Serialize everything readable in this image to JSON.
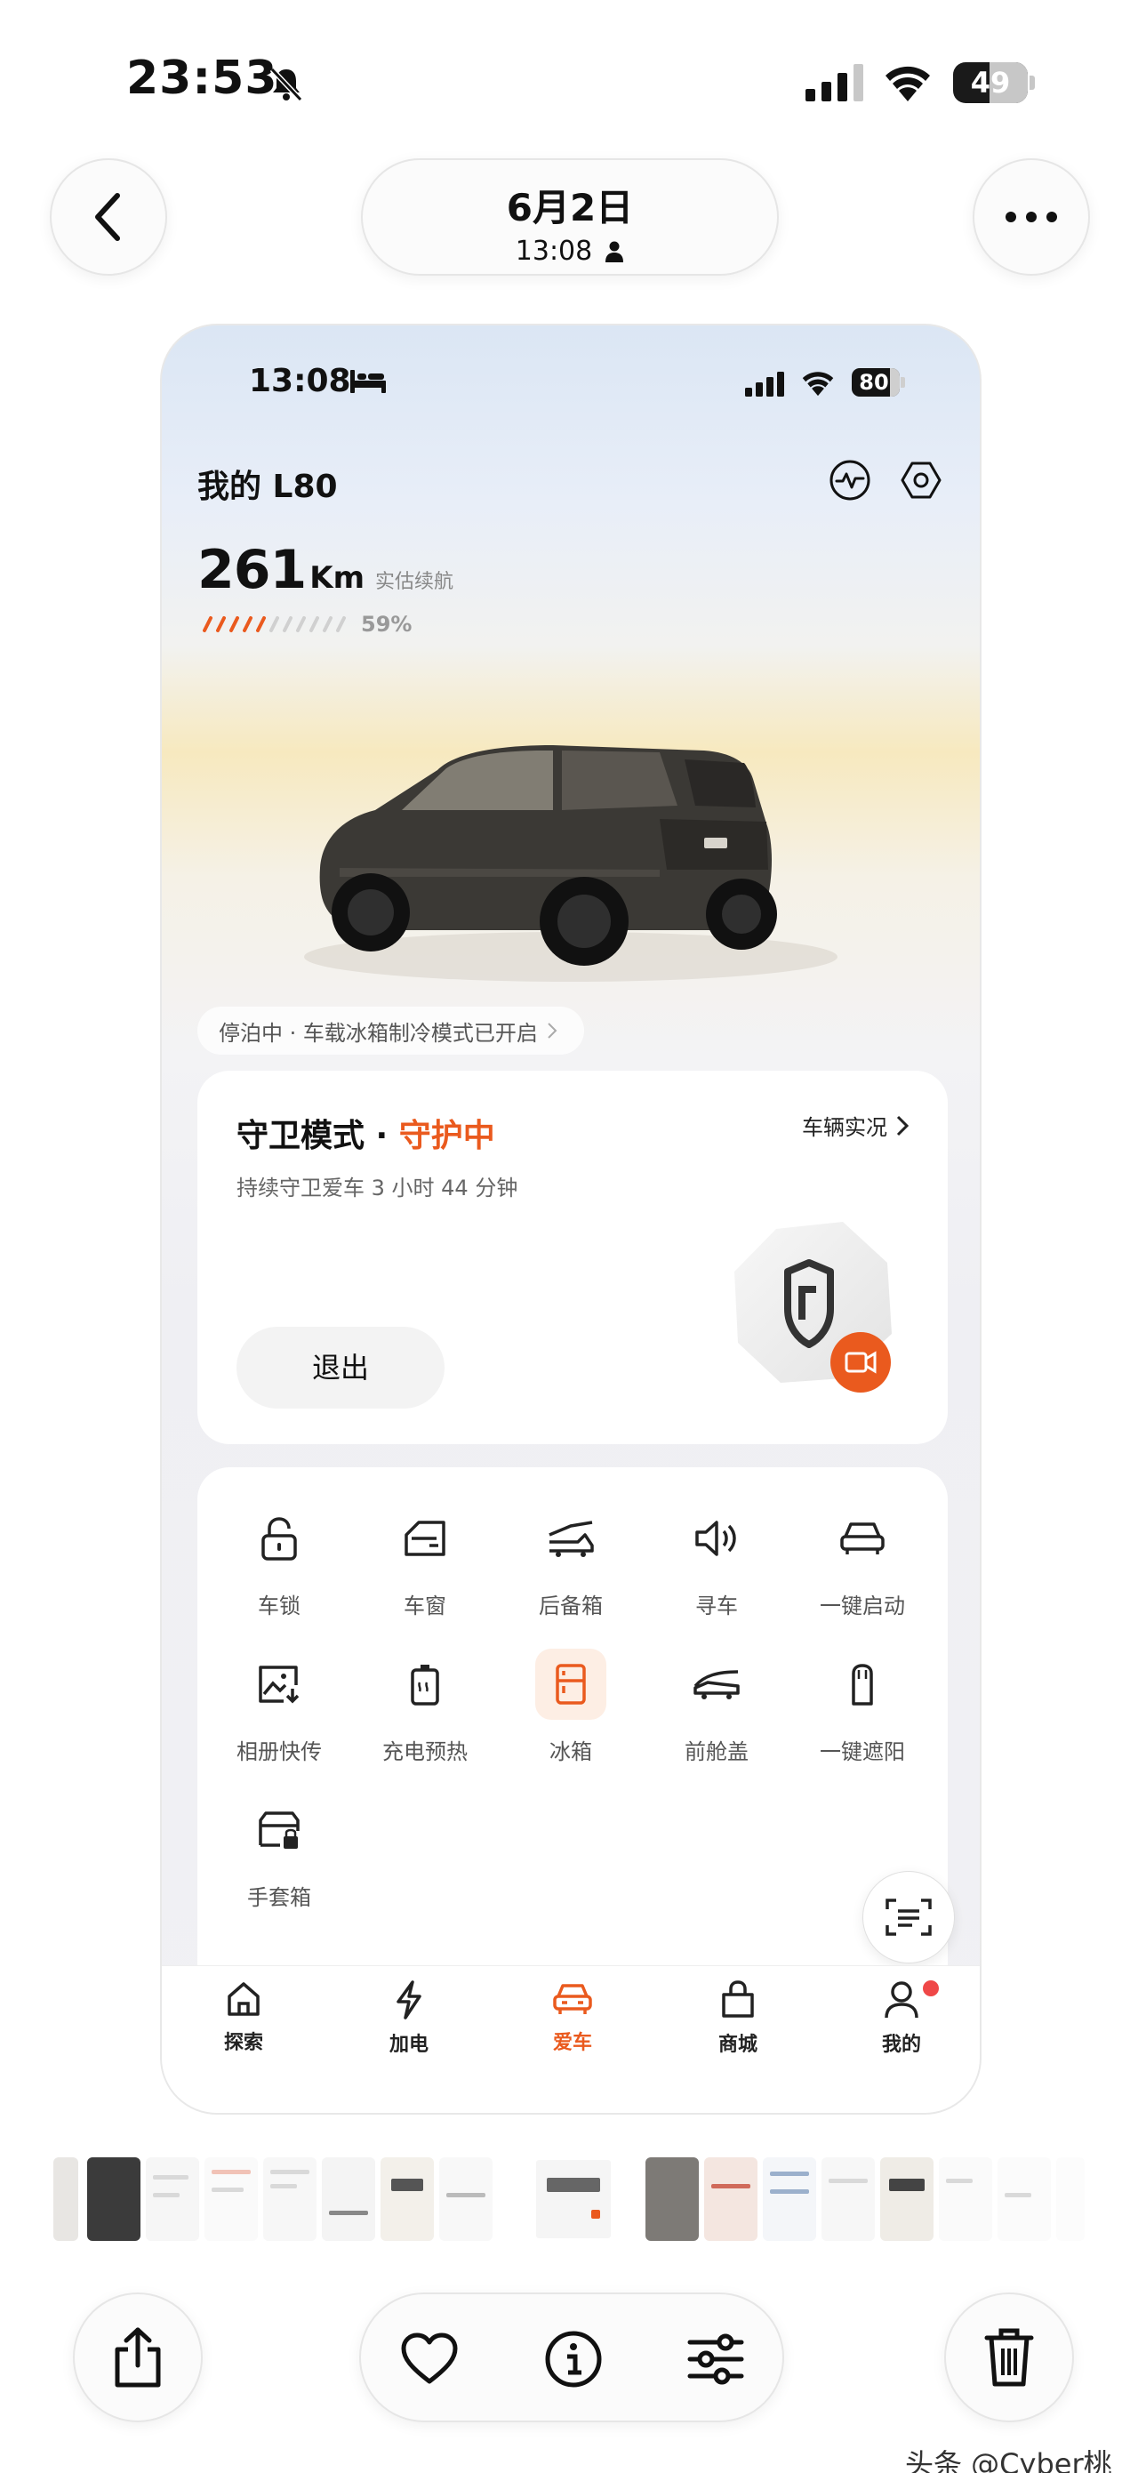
{
  "os_status": {
    "time": "23:53",
    "battery": "49",
    "battery_level": 0.49
  },
  "photo_header": {
    "date": "6月2日",
    "time": "13:08"
  },
  "app": {
    "status": {
      "time": "13:08",
      "battery": "80",
      "battery_level": 0.8
    },
    "car_name": "我的 L80",
    "range": {
      "value": "261",
      "unit": "Km",
      "label": "实估续航",
      "percent_text": "59%",
      "percent": 59
    },
    "park_notice": "停泊中 · 车载冰箱制冷模式已开启",
    "guard": {
      "title": "守卫模式 · ",
      "status": "守护中",
      "subtitle": "持续守卫爱车 3 小时 44 分钟",
      "link": "车辆实况",
      "exit": "退出"
    },
    "controls": [
      {
        "label": "车锁",
        "icon": "lock-icon"
      },
      {
        "label": "车窗",
        "icon": "car-window-icon"
      },
      {
        "label": "后备箱",
        "icon": "trunk-icon"
      },
      {
        "label": "寻车",
        "icon": "speaker-icon"
      },
      {
        "label": "一键启动",
        "icon": "car-start-icon"
      },
      {
        "label": "相册快传",
        "icon": "photo-transfer-icon"
      },
      {
        "label": "充电预热",
        "icon": "battery-preheat-icon"
      },
      {
        "label": "冰箱",
        "icon": "fridge-icon",
        "active": true
      },
      {
        "label": "前舱盖",
        "icon": "hood-icon"
      },
      {
        "label": "一键遮阳",
        "icon": "sunshade-icon"
      },
      {
        "label": "手套箱",
        "icon": "glovebox-icon"
      }
    ],
    "tabs": [
      {
        "label": "探索",
        "icon": "home-icon"
      },
      {
        "label": "加电",
        "icon": "lightning-icon"
      },
      {
        "label": "爱车",
        "icon": "car-icon",
        "active": true
      },
      {
        "label": "商城",
        "icon": "bag-icon"
      },
      {
        "label": "我的",
        "icon": "profile-icon",
        "badge": true
      }
    ]
  },
  "watermark": "头条 @Cyber桃",
  "colors": {
    "accent": "#ea5a1e",
    "badge": "#ef4747"
  }
}
